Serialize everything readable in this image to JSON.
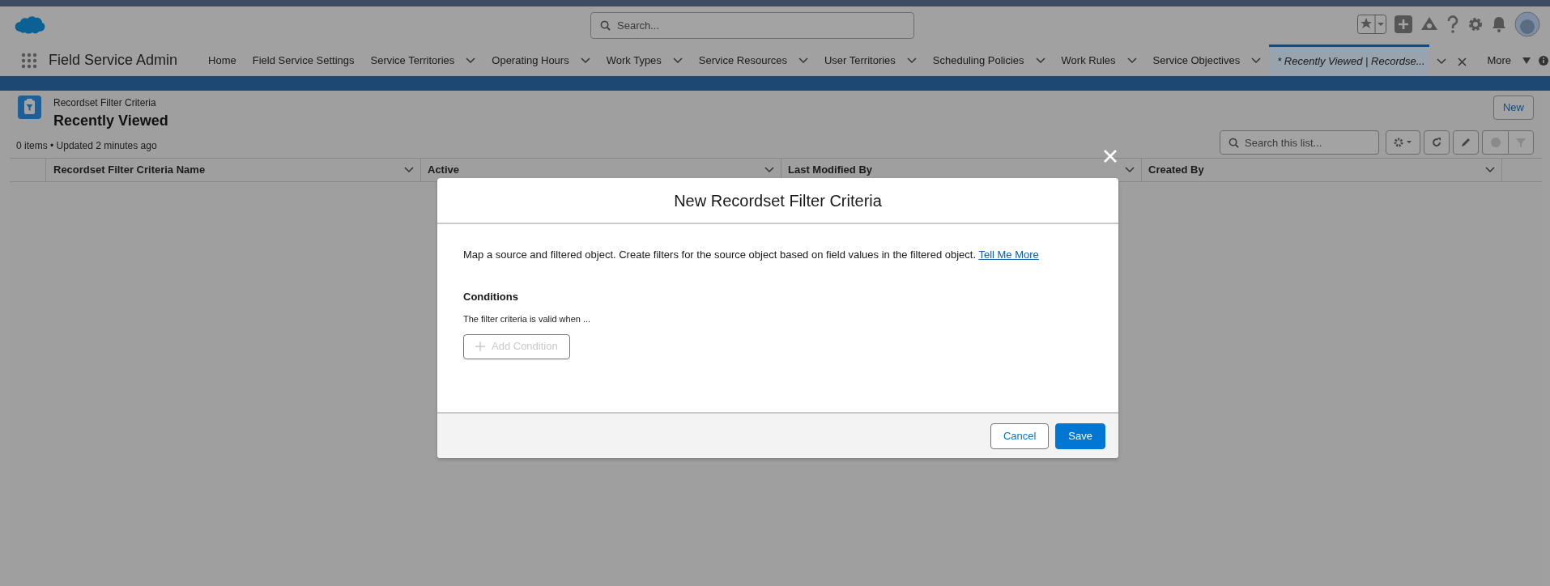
{
  "header": {
    "search_placeholder": "Search..."
  },
  "nav": {
    "app_name": "Field Service Admin",
    "tabs": [
      {
        "label": "Home",
        "dropdown": false,
        "selected": false,
        "closable": false
      },
      {
        "label": "Field Service Settings",
        "dropdown": false,
        "selected": false,
        "closable": false
      },
      {
        "label": "Service Territories",
        "dropdown": true,
        "selected": false,
        "closable": false
      },
      {
        "label": "Operating Hours",
        "dropdown": true,
        "selected": false,
        "closable": false
      },
      {
        "label": "Work Types",
        "dropdown": true,
        "selected": false,
        "closable": false
      },
      {
        "label": "Service Resources",
        "dropdown": true,
        "selected": false,
        "closable": false
      },
      {
        "label": "User Territories",
        "dropdown": true,
        "selected": false,
        "closable": false
      },
      {
        "label": "Scheduling Policies",
        "dropdown": true,
        "selected": false,
        "closable": false
      },
      {
        "label": "Work Rules",
        "dropdown": true,
        "selected": false,
        "closable": false
      },
      {
        "label": "Service Objectives",
        "dropdown": true,
        "selected": false,
        "closable": false
      },
      {
        "label": "* Recently Viewed | Recordse...",
        "dropdown": true,
        "selected": true,
        "closable": true
      }
    ],
    "more": "More"
  },
  "list_view": {
    "object": "Recordset Filter Criteria",
    "title": "Recently Viewed",
    "status": "0 items • Updated 2 minutes ago",
    "new_button": "New",
    "search_placeholder": "Search this list...",
    "columns": [
      "Recordset Filter Criteria Name",
      "Active",
      "Last Modified By",
      "Created By"
    ]
  },
  "modal": {
    "title": "New Recordset Filter Criteria",
    "description": "Map a source and filtered object. Create filters for the source object based on field values in the filtered object.",
    "link": "Tell Me More",
    "section": "Conditions",
    "hint": "The filter criteria is valid when ...",
    "add_button": {
      "label": "Add Condition",
      "disabled": true
    },
    "buttons": [
      {
        "label": "Cancel",
        "kind": "neutral"
      },
      {
        "label": "Save",
        "kind": "brand"
      }
    ]
  }
}
